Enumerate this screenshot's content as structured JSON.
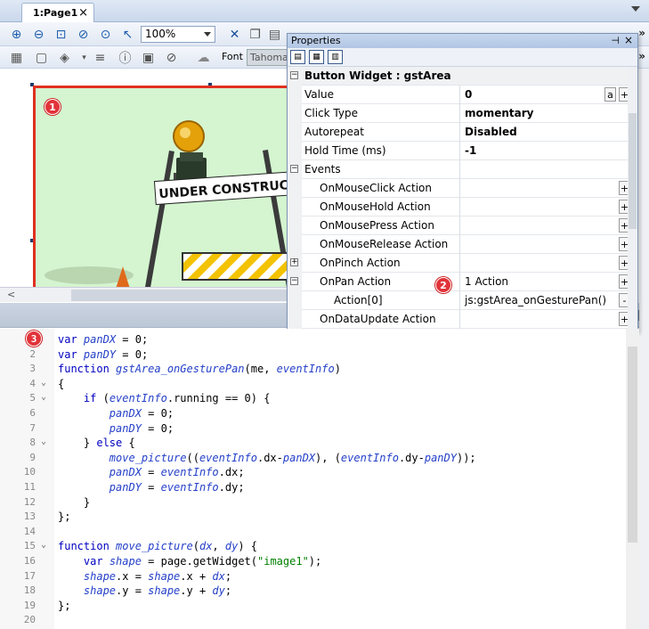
{
  "tabs": [
    {
      "label": "1:Page1",
      "close": "×"
    }
  ],
  "toolbar": {
    "zoom_value": "100%",
    "font_label": "Font",
    "font_value": "Tahoma",
    "more_glyph": "»"
  },
  "canvas": {
    "badge": "1",
    "image_sign_text": "UNDER CONSTRUCTION"
  },
  "properties": {
    "title": "Properties",
    "pin_glyph": "⊣",
    "close_glyph": "×",
    "section_header": "Button Widget : gstArea",
    "badge": "2",
    "rows": [
      {
        "name": "Value",
        "value": "0",
        "buttons": [
          "a",
          "+"
        ]
      },
      {
        "name": "Click Type",
        "value": "momentary"
      },
      {
        "name": "Autorepeat",
        "value": "Disabled"
      },
      {
        "name": "Hold Time (ms)",
        "value": "-1"
      },
      {
        "name": "Events",
        "value": ""
      },
      {
        "name": "OnMouseClick Action",
        "value": "",
        "buttons": [
          "+"
        ]
      },
      {
        "name": "OnMouseHold Action",
        "value": "",
        "buttons": [
          "+"
        ]
      },
      {
        "name": "OnMousePress Action",
        "value": "",
        "buttons": [
          "+"
        ]
      },
      {
        "name": "OnMouseRelease Action",
        "value": "",
        "buttons": [
          "+"
        ]
      },
      {
        "name": "OnPinch Action",
        "value": "",
        "buttons": [
          "+"
        ]
      },
      {
        "name": "OnPan Action",
        "value": "1 Action",
        "buttons": [
          "+"
        ]
      },
      {
        "name": "Action[0]",
        "value": "js:gstArea_onGesturePan()",
        "buttons": [
          "-"
        ]
      },
      {
        "name": "OnDataUpdate Action",
        "value": "",
        "buttons": [
          "+"
        ]
      }
    ]
  },
  "editor": {
    "badge": "3",
    "lines": [
      {
        "n": "1",
        "fold": "",
        "code": "var panDX = 0;"
      },
      {
        "n": "2",
        "fold": "",
        "code": "var panDY = 0;"
      },
      {
        "n": "3",
        "fold": "",
        "code": "function gstArea_onGesturePan(me, eventInfo)"
      },
      {
        "n": "4",
        "fold": "⌄",
        "code": "{"
      },
      {
        "n": "5",
        "fold": "⌄",
        "code": "    if (eventInfo.running == 0) {"
      },
      {
        "n": "6",
        "fold": "",
        "code": "        panDX = 0;"
      },
      {
        "n": "7",
        "fold": "",
        "code": "        panDY = 0;"
      },
      {
        "n": "8",
        "fold": "⌄",
        "code": "    } else {"
      },
      {
        "n": "9",
        "fold": "",
        "code": "        move_picture((eventInfo.dx-panDX), (eventInfo.dy-panDY));"
      },
      {
        "n": "10",
        "fold": "",
        "code": "        panDX = eventInfo.dx;"
      },
      {
        "n": "11",
        "fold": "",
        "code": "        panDY = eventInfo.dy;"
      },
      {
        "n": "12",
        "fold": "",
        "code": "    }"
      },
      {
        "n": "13",
        "fold": "",
        "code": "};"
      },
      {
        "n": "14",
        "fold": "",
        "code": ""
      },
      {
        "n": "15",
        "fold": "⌄",
        "code": "function move_picture(dx, dy) {"
      },
      {
        "n": "16",
        "fold": "",
        "code": "    var shape = page.getWidget(\"image1\");"
      },
      {
        "n": "17",
        "fold": "",
        "code": "    shape.x = shape.x + dx;"
      },
      {
        "n": "18",
        "fold": "",
        "code": "    shape.y = shape.y + dy;"
      },
      {
        "n": "19",
        "fold": "",
        "code": "};"
      },
      {
        "n": "20",
        "fold": "",
        "code": ""
      }
    ]
  },
  "colors": {
    "badge": "#e2333a",
    "selection_border": "#e03020",
    "keyword": "#0000c0",
    "italic_ident": "#2540c8"
  }
}
